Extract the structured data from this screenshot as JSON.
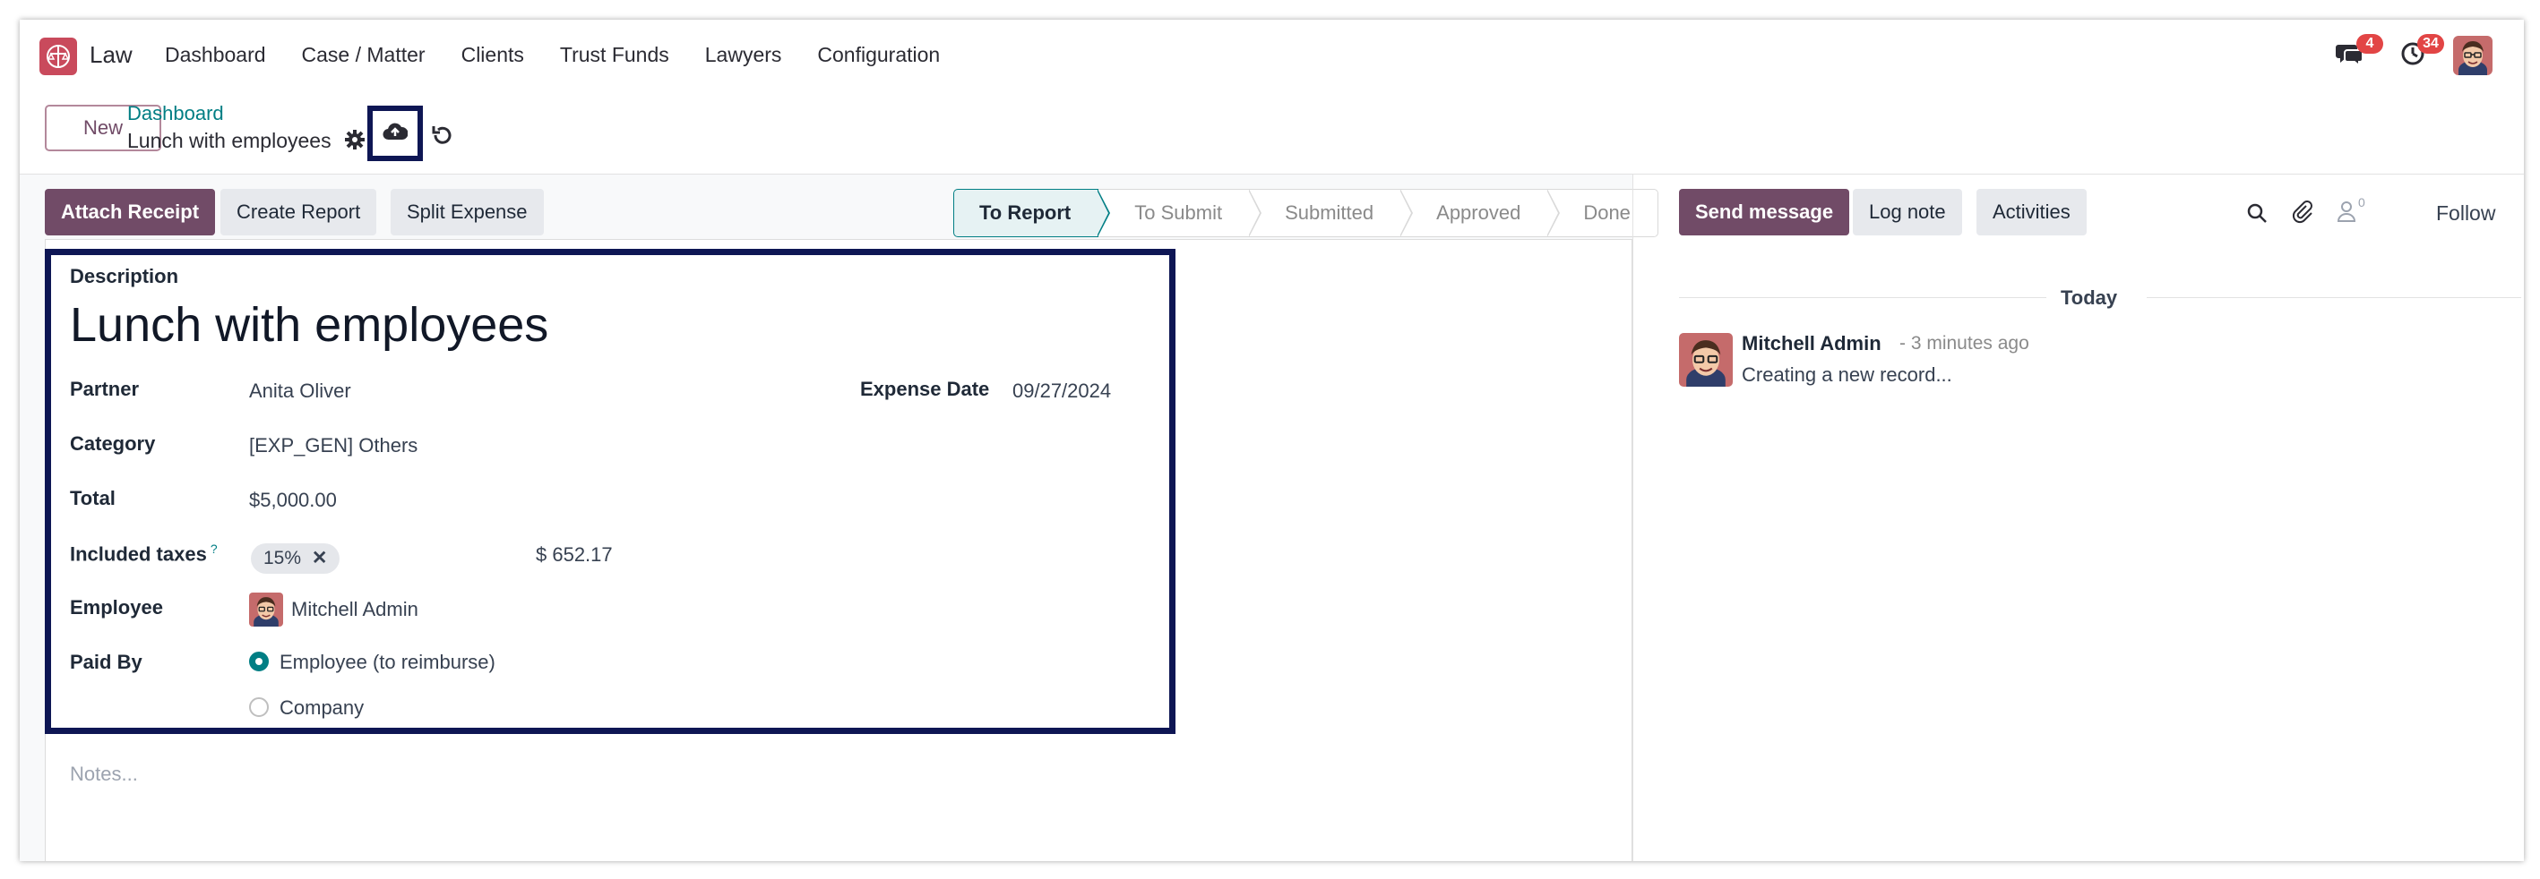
{
  "navbar": {
    "app_name": "Law",
    "menu": [
      "Dashboard",
      "Case / Matter",
      "Clients",
      "Trust Funds",
      "Lawyers",
      "Configuration"
    ],
    "messages_badge": "4",
    "activities_badge": "34"
  },
  "control_panel": {
    "new_label": "New",
    "breadcrumb_parent": "Dashboard",
    "breadcrumb_current": "Lunch with employees"
  },
  "form": {
    "buttons": {
      "attach_receipt": "Attach Receipt",
      "create_report": "Create Report",
      "split_expense": "Split Expense"
    },
    "stages": [
      {
        "label": "To Report",
        "active": true
      },
      {
        "label": "To Submit",
        "active": false
      },
      {
        "label": "Submitted",
        "active": false
      },
      {
        "label": "Approved",
        "active": false
      },
      {
        "label": "Done",
        "active": false
      }
    ],
    "description_label": "Description",
    "title": "Lunch with employees",
    "partner_label": "Partner",
    "partner_value": "Anita Oliver",
    "expense_date_label": "Expense Date",
    "expense_date_value": "09/27/2024",
    "category_label": "Category",
    "category_value": "[EXP_GEN] Others",
    "total_label": "Total",
    "total_value": "$5,000.00",
    "taxes_label": "Included taxes",
    "taxes_help": "?",
    "tax_tag": "15%",
    "tax_amount": "$ 652.17",
    "employee_label": "Employee",
    "employee_value": "Mitchell Admin",
    "paid_by_label": "Paid By",
    "paid_by_options": [
      {
        "label": "Employee (to reimburse)",
        "selected": true
      },
      {
        "label": "Company",
        "selected": false
      }
    ],
    "notes_placeholder": "Notes..."
  },
  "chatter": {
    "send_message": "Send message",
    "log_note": "Log note",
    "activities": "Activities",
    "followers_count": "0",
    "follow": "Follow",
    "today": "Today",
    "message": {
      "author": "Mitchell Admin",
      "time": "- 3 minutes ago",
      "body": "Creating a new record..."
    }
  },
  "colors": {
    "primary": "#714b67",
    "teal": "#017e84",
    "highlight": "#0e1654",
    "badge": "#e24545"
  },
  "icons": [
    "app-logo-icon",
    "messages-icon",
    "clock-icon",
    "gear-icon",
    "cloud-upload-icon",
    "undo-icon",
    "search-icon",
    "paperclip-icon",
    "user-icon"
  ]
}
